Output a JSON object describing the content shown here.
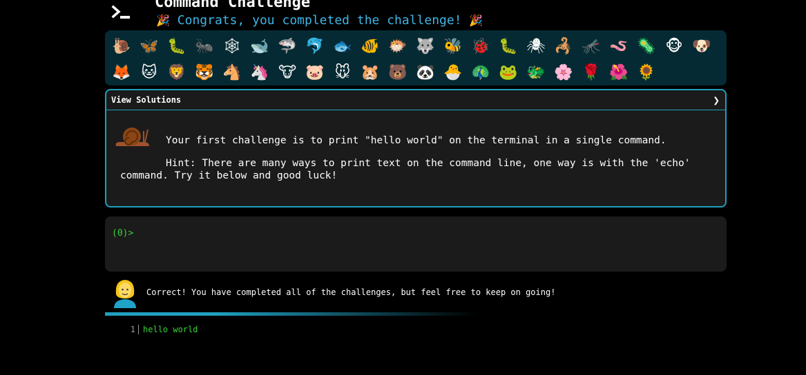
{
  "header": {
    "logo_icon": "terminal-icon",
    "title": "Command Challenge",
    "congrats_text": "Congrats, you completed the challenge!",
    "party_emoji": "🎉"
  },
  "emoji_panel": {
    "row1": [
      "🐌",
      "🦋",
      "🐛",
      "🐜",
      "🕸",
      "🐋",
      "🦈",
      "🐬",
      "🐟",
      "🐠",
      "🐡",
      "🐺",
      "🐝",
      "🐞",
      "🐛",
      "🕷",
      "🦂",
      "🦟",
      "🪱",
      "🦠",
      "🐵",
      "🐶"
    ],
    "row2": [
      "🦊",
      "🐱",
      "🦁",
      "🐯",
      "🐴",
      "🦄",
      "🐮",
      "🐷",
      "🐭",
      "🐹",
      "🐻",
      "🐼",
      "🐣",
      "🦚",
      "🐸",
      "🐲",
      "🌸",
      "🌹",
      "🌺",
      "🌻"
    ]
  },
  "challenge": {
    "view_solutions": "View Solutions",
    "chevron": "❯",
    "paragraph1": "Your first challenge is to print \"hello world\" on the terminal in a single command.",
    "paragraph2": "Hint: There are many ways to print text on the command line, one way is with the 'echo' command. Try it below and good luck!"
  },
  "terminal": {
    "prompt": "(0)>"
  },
  "feedback": {
    "message": "Correct! You have completed all of the challenges, but feel free to keep on going!"
  },
  "output": {
    "line_number": "1",
    "text": "hello world"
  },
  "colors": {
    "accent": "#1f9fbf",
    "congrats": "#3fb5e6",
    "prompt_green": "#39d13a",
    "panel_bg": "#062a33",
    "box_bg": "#1b1b1b"
  }
}
